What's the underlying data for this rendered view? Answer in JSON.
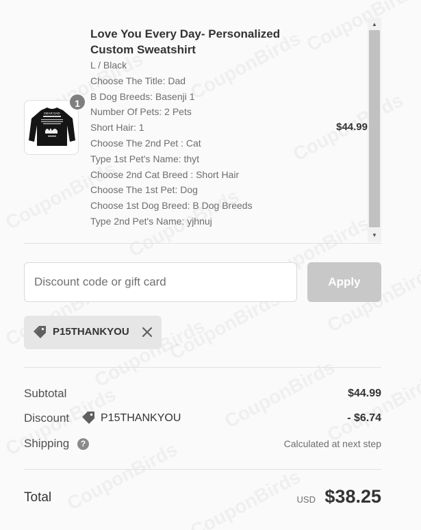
{
  "product": {
    "title": "Love You Every Day- Personalized Custom Sweatshirt",
    "variant": "L / Black",
    "quantity": "1",
    "price": "$44.99",
    "image_text": "DEAR DAD",
    "properties": [
      "Choose The Title: Dad",
      "B Dog Breeds: Basenji 1",
      "Number Of Pets: 2 Pets",
      "Short Hair: 1",
      "Choose The 2nd Pet : Cat",
      "Type 1st Pet's Name: thyt",
      "Choose 2nd Cat Breed : Short Hair",
      "Choose The 1st Pet: Dog",
      "Choose 1st Dog Breed: B Dog Breeds",
      "Type 2nd Pet's Name: yjhnuj"
    ]
  },
  "discount": {
    "placeholder": "Discount code or gift card",
    "apply_label": "Apply",
    "applied_code": "P15THANKYOU"
  },
  "summary": {
    "subtotal_label": "Subtotal",
    "subtotal_value": "$44.99",
    "discount_label": "Discount",
    "discount_code": "P15THANKYOU",
    "discount_value": "- $6.74",
    "shipping_label": "Shipping",
    "shipping_value": "Calculated at next step",
    "total_label": "Total",
    "currency": "USD",
    "total_value": "$38.25"
  },
  "watermark": "CouponBirds",
  "colors": {
    "apply_disabled": "#c8c8c8",
    "chip_bg": "#e6e6e6",
    "badge": "#7f7f7f"
  }
}
